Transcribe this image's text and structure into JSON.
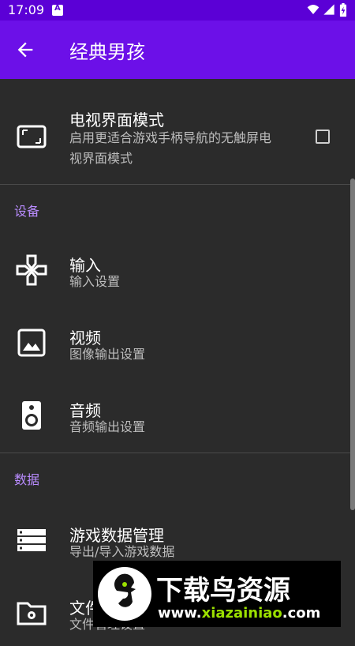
{
  "status_bar": {
    "time": "17:09"
  },
  "app_bar": {
    "title": "经典男孩"
  },
  "settings": {
    "tv_mode": {
      "title": "电视界面模式",
      "subtitle_line1": "启用更适合游戏手柄导航的无触屏电",
      "subtitle_line2": "视界面模式"
    },
    "device_section": "设备",
    "input": {
      "title": "输入",
      "subtitle": "输入设置"
    },
    "video": {
      "title": "视频",
      "subtitle": "图像输出设置"
    },
    "audio": {
      "title": "音频",
      "subtitle": "音频输出设置"
    },
    "data_section": "数据",
    "game_data": {
      "title": "游戏数据管理",
      "subtitle": "导出/导入游戏数据"
    },
    "file": {
      "title": "文件",
      "subtitle": "文件管理设置"
    }
  },
  "watermark": {
    "title": "下载鸟资源",
    "url_prefix": "www.",
    "url_main": "xiazainiao",
    "url_suffix": ".com"
  },
  "colors": {
    "status_bar": "#5b00d6",
    "app_bar": "#6c10e8",
    "background": "#2b2b2b",
    "section_header": "#b98cff"
  },
  "icons": {
    "back": "arrow-left-icon",
    "tv": "tv-icon",
    "input": "gamepad-icon",
    "video": "image-icon",
    "audio": "speaker-icon",
    "game_data": "storage-icon",
    "file": "folder-gear-icon"
  }
}
